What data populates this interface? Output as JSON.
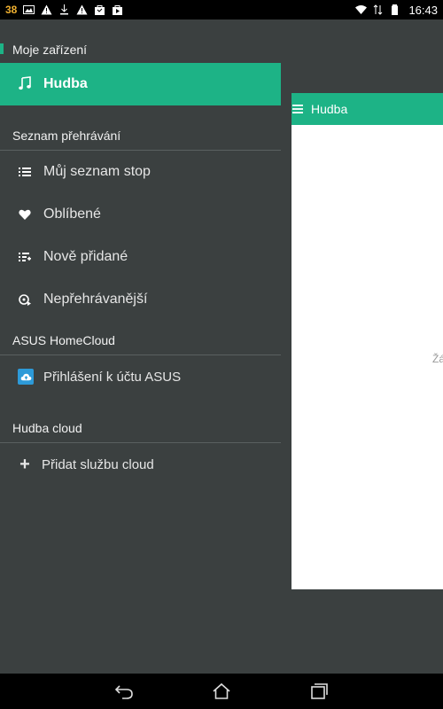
{
  "status_bar": {
    "notification_count": "38",
    "time": "16:43"
  },
  "background_app": {
    "title": "Hudba",
    "empty_hint": "Žá"
  },
  "drawer": {
    "my_device_header": "Moje zařízení",
    "active_item": {
      "label": "Hudba",
      "icon": "music-note-icon"
    },
    "playlist_header": "Seznam přehrávání",
    "playlist_items": [
      {
        "label": "Můj seznam stop",
        "icon": "list-icon"
      },
      {
        "label": "Oblíbené",
        "icon": "heart-icon"
      },
      {
        "label": "Nově přidané",
        "icon": "list-add-icon"
      },
      {
        "label": "Nepřehrávanější",
        "icon": "play-count-icon"
      }
    ],
    "homecloud_header": "ASUS HomeCloud",
    "homecloud_item": {
      "label": "Přihlášení k účtu ASUS",
      "icon": "cloud-icon"
    },
    "cloud_header": "Hudba cloud",
    "cloud_item": {
      "label": "Přidat službu cloud",
      "icon": "plus-icon"
    }
  },
  "colors": {
    "accent": "#1db386",
    "drawer_bg": "#3b4040",
    "cloud_icon_bg": "#2d9ad8"
  }
}
